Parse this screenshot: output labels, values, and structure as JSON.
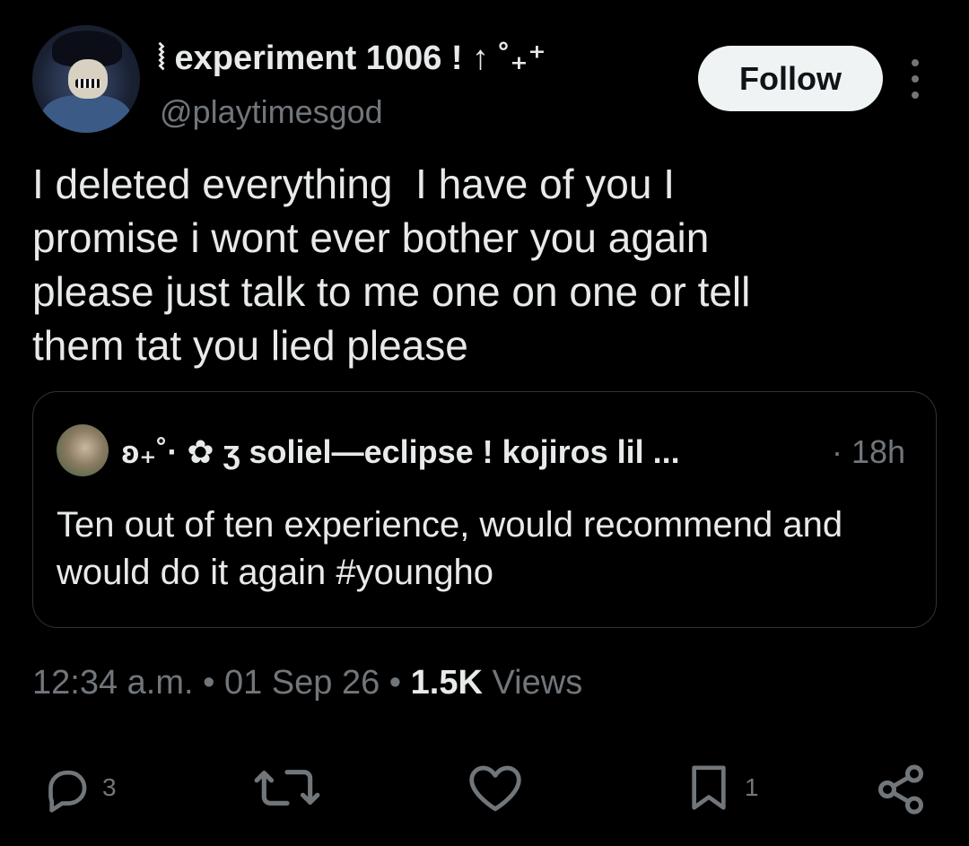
{
  "author": {
    "display_name": "⦚ experiment 1006 ! ↑ ˚₊⁺",
    "handle": "@playtimesgod",
    "follow_label": "Follow"
  },
  "tweet": {
    "text": "I deleted everything  I have of you I\npromise i wont ever bother you again\nplease just talk to me one on one or tell\nthem tat you lied please"
  },
  "quote": {
    "display_name": "ʚ₊˚· ✿ ʒ soliel—eclipse ! kojiros lil ...",
    "time": "· 18h",
    "text": "Ten out of ten experience, would recommend and would do it again #youngho"
  },
  "meta": {
    "time": "12:34 a.m.",
    "sep1": " • ",
    "date": "01 Sep 26",
    "sep2": " • ",
    "views_count": "1.5K",
    "views_label": " Views"
  },
  "actions": {
    "reply_count": "3",
    "bookmark_count": "1"
  },
  "colors": {
    "background": "#000000",
    "text_primary": "#e7e9ea",
    "text_secondary": "#71767b",
    "border": "#2f3336",
    "follow_bg": "#eff3f4"
  }
}
